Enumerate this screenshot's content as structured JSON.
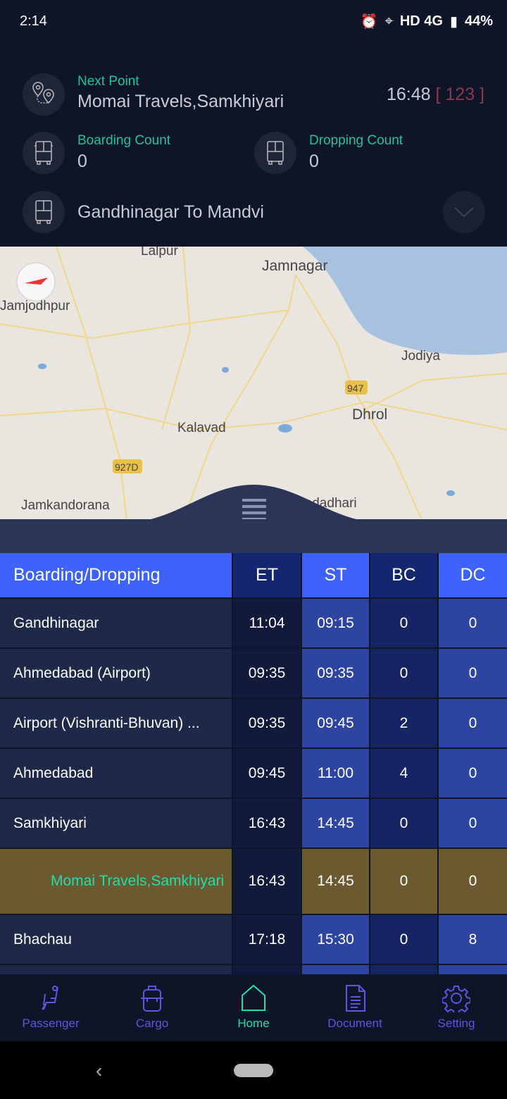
{
  "status_bar": {
    "time": "2:14",
    "network": "HD 4G",
    "battery": "44%"
  },
  "header": {
    "next_point_label": "Next Point",
    "next_point_value": "Momai Travels,Samkhiyari",
    "time": "16:48",
    "delay": "[ 123 ]",
    "boarding_count_label": "Boarding Count",
    "boarding_count": "0",
    "dropping_count_label": "Dropping Count",
    "dropping_count": "0",
    "route": "Gandhinagar To Mandvi"
  },
  "map": {
    "labels": [
      "Lalpur",
      "Jamnagar",
      "Jamjodhpur",
      "Jodiya",
      "947",
      "Dhrol",
      "Kalavad",
      "927D",
      "Jamkandorana",
      "Padadhari"
    ]
  },
  "table": {
    "headers": [
      "Boarding/Dropping",
      "ET",
      "ST",
      "BC",
      "DC"
    ],
    "rows": [
      [
        "Gandhinagar",
        "11:04",
        "09:15",
        "0",
        "0"
      ],
      [
        "Ahmedabad (Airport)",
        "09:35",
        "09:35",
        "0",
        "0"
      ],
      [
        "Airport (Vishranti-Bhuvan) ...",
        "09:35",
        "09:45",
        "2",
        "0"
      ],
      [
        "Ahmedabad",
        "09:45",
        "11:00",
        "4",
        "0"
      ],
      [
        "Samkhiyari",
        "16:43",
        "14:45",
        "0",
        "0"
      ],
      [
        "Momai Travels,Samkhiyari",
        "16:43",
        "14:45",
        "0",
        "0"
      ],
      [
        "Bhachau",
        "17:18",
        "15:30",
        "0",
        "8"
      ]
    ],
    "highlighted_row": 5
  },
  "nav": {
    "items": [
      "Passenger",
      "Cargo",
      "Home",
      "Document",
      "Setting"
    ],
    "active": "Home"
  },
  "colors": {
    "accent_green": "#1fc49a",
    "header_blue": "#3d63fa",
    "highlight": "#6b5a30",
    "delay_red": "#8a3a4a",
    "nav_purple": "#5b57e0"
  }
}
